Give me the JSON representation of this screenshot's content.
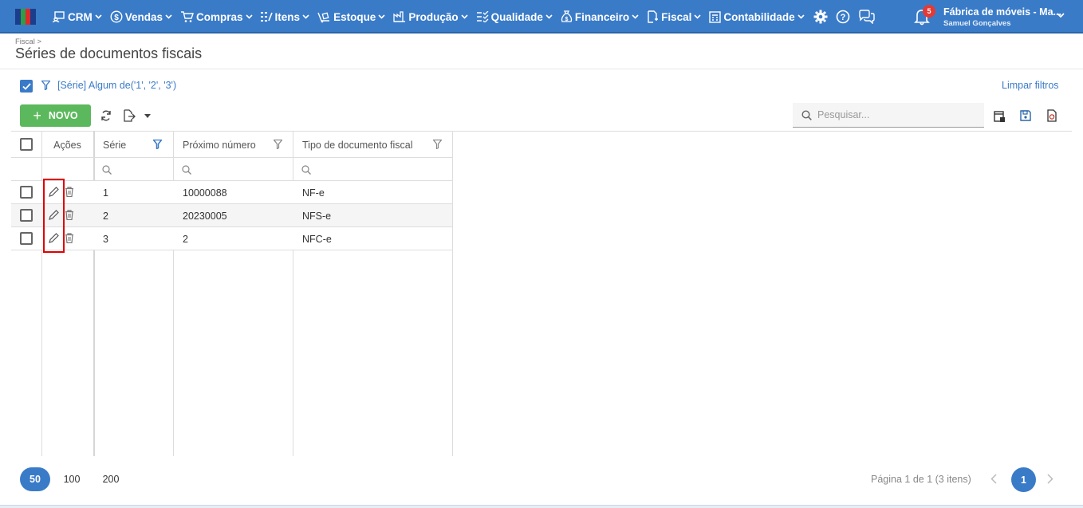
{
  "topbar": {
    "nav": [
      {
        "label": "CRM",
        "icon": "crm-icon"
      },
      {
        "label": "Vendas",
        "icon": "dollar-icon"
      },
      {
        "label": "Compras",
        "icon": "cart-icon"
      },
      {
        "label": "Itens",
        "icon": "items-icon"
      },
      {
        "label": "Estoque",
        "icon": "stock-icon"
      },
      {
        "label": "Produção",
        "icon": "factory-icon"
      },
      {
        "label": "Qualidade",
        "icon": "quality-icon"
      },
      {
        "label": "Financeiro",
        "icon": "moneybag-icon"
      },
      {
        "label": "Fiscal",
        "icon": "fiscal-icon"
      },
      {
        "label": "Contabilidade",
        "icon": "calculator-icon"
      }
    ],
    "notifications_count": "5",
    "company_name": "Fábrica de móveis - Ma...",
    "user_name": "Samuel Gonçalves",
    "colors": {
      "bar": "#3a7bc8",
      "accent": "#3a7bc8",
      "success": "#5cb85c",
      "highlight": "#e00000"
    }
  },
  "header": {
    "breadcrumb": "Fiscal >",
    "title": "Séries de documentos fiscais"
  },
  "filter": {
    "text": "[Série] Algum de('1', '2', '3')",
    "clear_label": "Limpar filtros"
  },
  "toolbar": {
    "new_label": "NOVO",
    "search_placeholder": "Pesquisar..."
  },
  "grid": {
    "columns": {
      "actions": "Ações",
      "serie": "Série",
      "next_number": "Próximo número",
      "doc_type": "Tipo de documento fiscal"
    },
    "rows": [
      {
        "serie": "1",
        "next_number": "10000088",
        "doc_type": "NF-e"
      },
      {
        "serie": "2",
        "next_number": "20230005",
        "doc_type": "NFS-e"
      },
      {
        "serie": "3",
        "next_number": "2",
        "doc_type": "NFC-e"
      }
    ]
  },
  "pager": {
    "sizes": [
      "50",
      "100",
      "200"
    ],
    "info": "Página 1 de 1 (3 itens)",
    "current_page": "1"
  }
}
